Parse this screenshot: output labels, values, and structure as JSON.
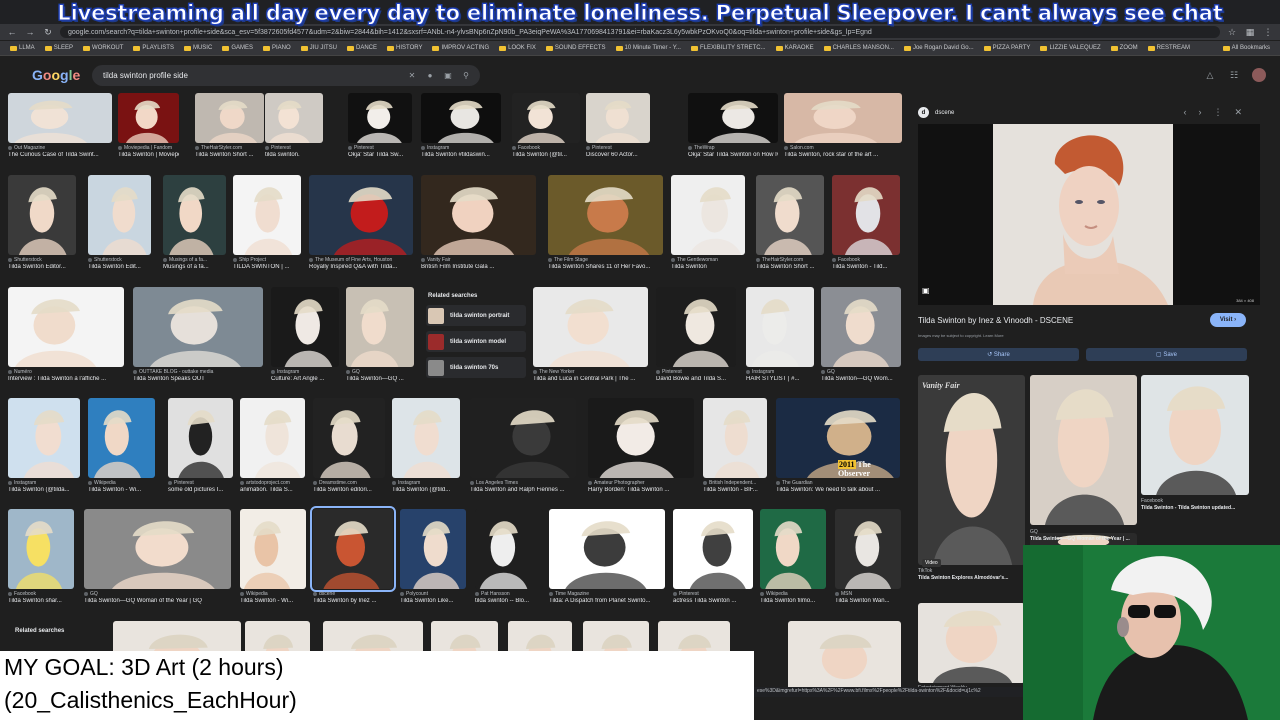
{
  "overlay": {
    "stream_title": "Livestreaming all day every day to eliminate loneliness. Perpetual Sleepover. I cant always see chat",
    "goal_line1": "MY GOAL: 3D Art (2 hours)",
    "goal_line2": "(20_Calisthenics_EachHour)",
    "status_url": "ese%3D&imgrefurl=https%3A%2F%2Fwww.bfi.films%2Fpeople%2Ftilda-swinton%2F&docid=uj1c%2"
  },
  "browser": {
    "url": "google.com/search?q=tilda+swinton+profile+side&sca_esv=5f3872605fd4577&udm=2&biw=2844&bih=1412&sxsrf=ANbL-n4-ylvsBNp6nZpN90b_PA3eiqPeWA%3A1770698413791&ei=rbaKacz3L6y5wbkPzOKvoQ0&oq=tilda+swinton+profile+side&gs_lp=Egnd",
    "bookmarks": [
      "LLMA",
      "SLEEP",
      "WORKOUT",
      "PLAYLISTS",
      "MUSIC",
      "GAMES",
      "PIANO",
      "JIU JITSU",
      "DANCE",
      "HISTORY",
      "IMPROV ACTING",
      "LOOK FIX",
      "SOUND EFFECTS",
      "10 Minute Timer - Y...",
      "FLEXIBILITY STRETC...",
      "KARAOKE",
      "CHARLES MANSON...",
      "Joe Rogan David Go...",
      "PIZZA PARTY",
      "LIZZIE VALEQUEZ",
      "ZOOM",
      "RESTREAM"
    ],
    "bookmarks_right": "All Bookmarks"
  },
  "google": {
    "logo": [
      "G",
      "o",
      "o",
      "g",
      "l",
      "e"
    ],
    "query": "tilda swinton profile side"
  },
  "results": [
    {
      "src": "Out Magazine",
      "title": "The Curious Case of Tilda Swint..."
    },
    {
      "src": "Moviepedia | Fandom",
      "title": "Tilda Swinton | Moviepedi..."
    },
    {
      "src": "TheHairStyler.com",
      "title": "Tilda Swinton Short ..."
    },
    {
      "src": "Pinterest",
      "title": "tilda swinton."
    },
    {
      "src": "Pinterest",
      "title": "Okja' Star Tilda Sw..."
    },
    {
      "src": "Instagram",
      "title": "Tilda Swinton #tildaswin..."
    },
    {
      "src": "Facebook",
      "title": "Tilda Swinton (@til..."
    },
    {
      "src": "Pinterest",
      "title": "Discover 60 Actor..."
    },
    {
      "src": "TheWrap",
      "title": "Okja' Star Tilda Swinton on How Iva..."
    },
    {
      "src": "Salon.com",
      "title": "Tilda Swinton, rock star of the art ..."
    },
    {
      "src": "Shutterstock",
      "title": "Tilda Swinton Editor..."
    },
    {
      "src": "Shutterstock",
      "title": "Tilda Swinton Edit..."
    },
    {
      "src": "Musings of a fa...",
      "title": "Musings of a fa..."
    },
    {
      "src": "Ship Project",
      "title": "TILDA SWINTON | ..."
    },
    {
      "src": "The Museum of Fine Arts, Houston",
      "title": "Royally Inspired Q&A with Tilda..."
    },
    {
      "src": "Vanity Fair",
      "title": "British Film Institute Gala ..."
    },
    {
      "src": "The Film Stage",
      "title": "Tilda Swinton Shares 11 of Her Favo..."
    },
    {
      "src": "The Gentlewoman",
      "title": "Tilda Swinton"
    },
    {
      "src": "TheHairStyler.com",
      "title": "Tilda Swinton Short ..."
    },
    {
      "src": "Facebook",
      "title": "Tilda Swinton - Tild..."
    },
    {
      "src": "Numéro",
      "title": "Interview : Tilda Swinton à l'affiche ..."
    },
    {
      "src": "OUTTAKE BLOG - outtake media",
      "title": "Tilda Swinton Speaks OUT"
    },
    {
      "src": "Instagram",
      "title": "Culture: Art Angle ..."
    },
    {
      "src": "GQ",
      "title": "Tilda Swinton—GQ ..."
    },
    {
      "src": "The New Yorker",
      "title": "Tilda and Luca in Central Park | The ..."
    },
    {
      "src": "Pinterest",
      "title": "David Bowie and Tilda S..."
    },
    {
      "src": "Instagram",
      "title": "HAIR STYLIST | #..."
    },
    {
      "src": "GQ",
      "title": "Tilda Swinton—GQ Wom..."
    },
    {
      "src": "Instagram",
      "title": "Tilda Swinton (@tilda..."
    },
    {
      "src": "Wikipedia",
      "title": "Tilda Swinton - Wi..."
    },
    {
      "src": "Pinterest",
      "title": "some old pictures I..."
    },
    {
      "src": "artstodoproject.com",
      "title": "animation. Tilda S..."
    },
    {
      "src": "Dreamstime.com",
      "title": "Tilda Swinton editori..."
    },
    {
      "src": "Instagram",
      "title": "Tilda Swinton (@tild..."
    },
    {
      "src": "Los Angeles Times",
      "title": "Tilda Swinton and Ralph Fiennes ..."
    },
    {
      "src": "Amateur Photographer",
      "title": "Harry Borden: Tilda Swinton ..."
    },
    {
      "src": "British Independent...",
      "title": "Tilda Swinton - BIF..."
    },
    {
      "src": "The Guardian",
      "title": "Tilda Swinton: We need to talk about ..."
    },
    {
      "src": "Facebook",
      "title": "Tilda Swinton shar..."
    },
    {
      "src": "GQ",
      "title": "Tilda Swinton—GQ Woman of the Year | GQ"
    },
    {
      "src": "Wikipedia",
      "title": "Tilda Swinton - Wi..."
    },
    {
      "src": "dscene",
      "title": "Tilda Swinton by Inez ..."
    },
    {
      "src": "Polycount",
      "title": "Tilda Swinton Like..."
    },
    {
      "src": "Pat Hansson",
      "title": "tilda swinton -- Blo..."
    },
    {
      "src": "Time Magazine",
      "title": "Tilda: A Dispatch from Planet Swinto..."
    },
    {
      "src": "Pinterest",
      "title": "actress Tilda Swinton ..."
    },
    {
      "src": "Wikipedia",
      "title": "Tilda Swinton filmo..."
    },
    {
      "src": "MSN",
      "title": "Tilda Swinton Wan..."
    }
  ],
  "related": {
    "heading": "Related searches",
    "items": [
      "tilda swinton portrait",
      "tilda swinton model",
      "tilda swinton 70s"
    ],
    "bottom_heading": "Related searches"
  },
  "image_labels": {
    "observer": "The Observer",
    "year": "2011"
  },
  "panel": {
    "source": "dscene",
    "title": "Tilda Swinton by Inez & Vinoodh - DSCENE",
    "visit": "Visit",
    "copyright": "Images may be subject to copyright. Learn More",
    "share": "Share",
    "save": "Save",
    "dims": "384 × 408",
    "lens_icon": "lens-icon",
    "related": [
      {
        "src": "Vanity Fair",
        "title": ""
      },
      {
        "src": "Facebook",
        "title": "Tilda Swinton - Tilda Swinton updated..."
      },
      {
        "src": "GQ",
        "title": "Tilda Swinton—GQ Woman of the Year | ..."
      },
      {
        "src": "TikTok",
        "title": "Tilda Swinton Explores Almodóvar's..."
      },
      {
        "src": "Entertainment Weekly",
        "title": ""
      }
    ],
    "video_badge": "Video"
  },
  "colors": {
    "accent": "#8ab4f8",
    "background": "#1f1f1f",
    "title_stroke": "#1e3a8a",
    "webcam_green": "#1b7a3a"
  }
}
